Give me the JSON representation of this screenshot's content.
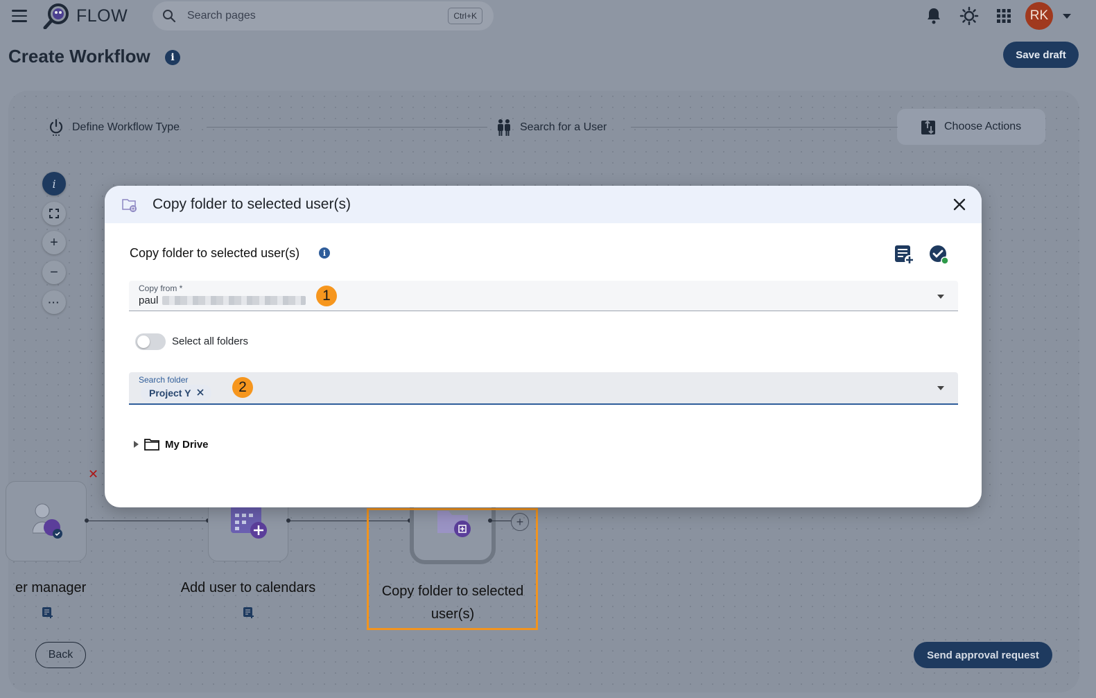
{
  "app": {
    "name": "FLOW"
  },
  "header": {
    "search_placeholder": "Search pages",
    "search_shortcut": "Ctrl+K",
    "avatar_initials": "RK"
  },
  "page": {
    "title": "Create Workflow",
    "save_draft_label": "Save draft"
  },
  "stepper": {
    "steps": [
      {
        "label": "Define Workflow Type",
        "icon": "power-icon"
      },
      {
        "label": "Search for a User",
        "icon": "users-icon"
      },
      {
        "label": "Choose Actions",
        "icon": "actions-icon",
        "active": true
      }
    ]
  },
  "canvas": {
    "nodes": [
      {
        "label": "er manager",
        "icon": "user-manager-icon"
      },
      {
        "label": "Add user to calendars",
        "icon": "calendar-add-icon"
      },
      {
        "label": "Copy folder to selected user(s)",
        "icon": "folder-copy-icon",
        "highlighted": true
      }
    ]
  },
  "footer": {
    "back_label": "Back",
    "send_label": "Send approval request"
  },
  "modal": {
    "title": "Copy folder to selected user(s)",
    "subtitle": "Copy folder to selected user(s)",
    "copy_from": {
      "label": "Copy from *",
      "value": "paul"
    },
    "select_all_label": "Select all folders",
    "select_all_on": false,
    "search_folder": {
      "label": "Search folder",
      "chip": "Project Y"
    },
    "tree": {
      "root_label": "My Drive"
    },
    "annotations": [
      "1",
      "2"
    ]
  },
  "colors": {
    "primary": "#1e3a5f",
    "accent_orange": "#f6961e",
    "highlight_border": "#f2941f",
    "avatar_bg": "#a0391e",
    "overlay_bg": "#8e96a3"
  }
}
